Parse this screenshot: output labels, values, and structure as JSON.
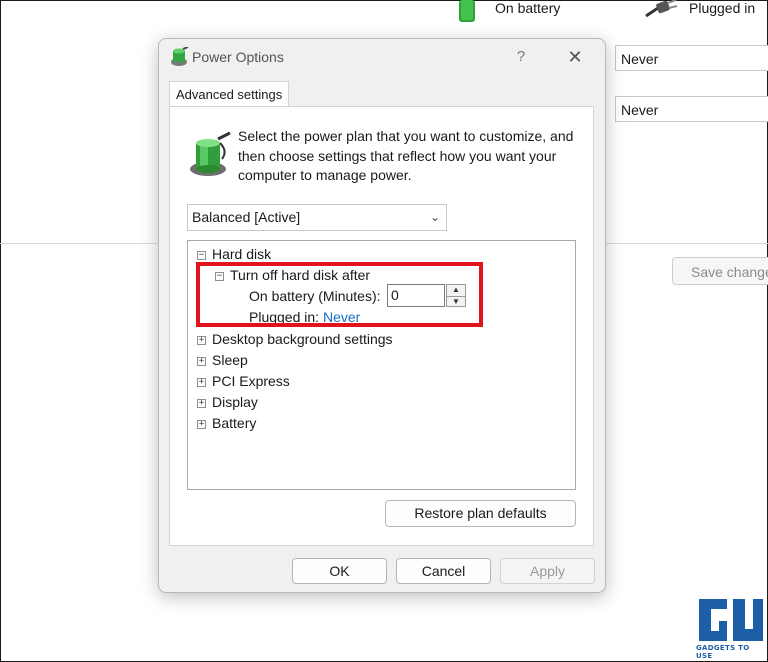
{
  "background": {
    "col_battery": "On battery",
    "col_plugged": "Plugged in",
    "select1": "Never",
    "select2": "Never",
    "save_button": "Save change"
  },
  "dialog": {
    "title": "Power Options",
    "help": "?",
    "close": "✕",
    "tab": "Advanced settings",
    "description": "Select the power plan that you want to customize, and then choose settings that reflect how you want your computer to manage power.",
    "plan_selected": "Balanced [Active]",
    "tree": {
      "hard_disk": "Hard disk",
      "turn_off": "Turn off hard disk after",
      "on_battery_label": "On battery (Minutes):",
      "on_battery_value": "0",
      "plugged_label": "Plugged in:",
      "plugged_value": "Never",
      "items": [
        "Desktop background settings",
        "Sleep",
        "PCI Express",
        "Display",
        "Battery"
      ]
    },
    "restore_button": "Restore plan defaults",
    "ok_button": "OK",
    "cancel_button": "Cancel",
    "apply_button": "Apply"
  },
  "watermark": "GADGETS TO USE",
  "colors": {
    "highlight": "#e2141b",
    "link": "#1a6fc4",
    "watermark": "#1d5fa6"
  }
}
